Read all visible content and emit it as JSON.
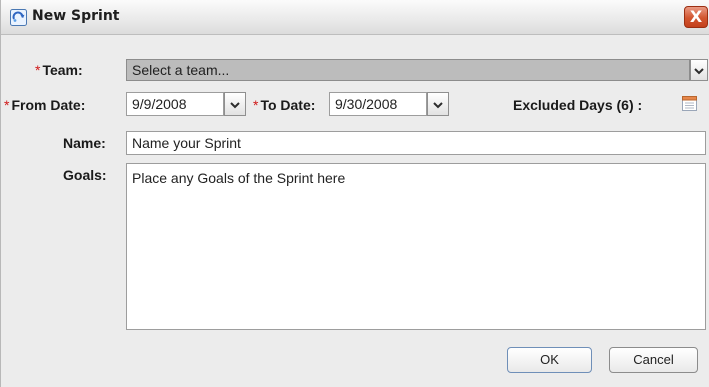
{
  "window": {
    "title": "New Sprint",
    "close_glyph": "X"
  },
  "form": {
    "team": {
      "required_mark": "*",
      "label": "Team:",
      "value": "Select a team..."
    },
    "from_date": {
      "required_mark": "*",
      "label": "From Date:",
      "value": "9/9/2008"
    },
    "to_date": {
      "required_mark": "*",
      "label": "To Date:",
      "value": "9/30/2008"
    },
    "excluded_days": {
      "label": "Excluded Days (6) :"
    },
    "name": {
      "label": "Name:",
      "value": "Name your Sprint"
    },
    "goals": {
      "label": "Goals:",
      "value": "Place any Goals of the Sprint here"
    }
  },
  "buttons": {
    "ok": "OK",
    "cancel": "Cancel"
  },
  "colors": {
    "required": "#d01818",
    "close_button": "#d2552f",
    "team_combo_background": "#bcbcbc"
  },
  "icons": {
    "title": "sprint-app-icon",
    "close": "close-icon",
    "dropdown": "chevron-down-icon",
    "excluded_days": "calendar-icon"
  }
}
